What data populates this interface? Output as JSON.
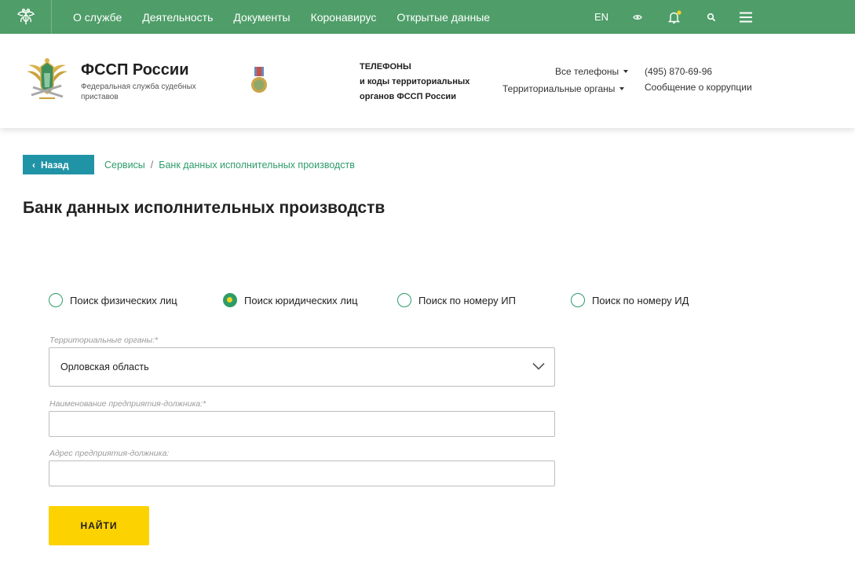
{
  "topnav": {
    "menu": [
      "О службе",
      "Деятельность",
      "Документы",
      "Коронавирус",
      "Открытые данные"
    ],
    "lang": "EN"
  },
  "header": {
    "title": "ФССП России",
    "subtitle": "Федеральная служба судебных приставов",
    "phones_block": [
      "ТЕЛЕФОНЫ",
      "и коды территориальных",
      "органов ФССП России"
    ],
    "all_phones": "Все телефоны",
    "territorial_organs": "Территориальные органы",
    "phone": "(495) 870-69-96",
    "corruption_report": "Сообщение о коррупции"
  },
  "breadcrumb": {
    "back": "Назад",
    "items": [
      "Сервисы",
      "Банк данных исполнительных производств"
    ]
  },
  "page_title": "Банк данных исполнительных производств",
  "search_modes": [
    {
      "label": "Поиск физических лиц",
      "checked": false
    },
    {
      "label": "Поиск юридических лиц",
      "checked": true
    },
    {
      "label": "Поиск по номеру ИП",
      "checked": false
    },
    {
      "label": "Поиск по номеру ИД",
      "checked": false
    }
  ],
  "form": {
    "region_label": "Территориальные органы:*",
    "region_value": "Орловская область",
    "company_label": "Наименование предприятия-должника:*",
    "company_value": "",
    "address_label": "Адрес предприятия-должника:",
    "address_value": "",
    "submit": "НАЙТИ"
  },
  "colors": {
    "nav_green": "#4f9e69",
    "accent_green": "#2e9c6a",
    "back_teal": "#2193a6",
    "button_yellow": "#fcd200",
    "notification_dot": "#f6d21e"
  },
  "icons": [
    "emblem-icon",
    "eye-icon",
    "bell-icon",
    "search-icon",
    "menu-icon",
    "chevron-left-icon",
    "chevron-down-icon",
    "caret-down-icon",
    "medal-icon"
  ]
}
